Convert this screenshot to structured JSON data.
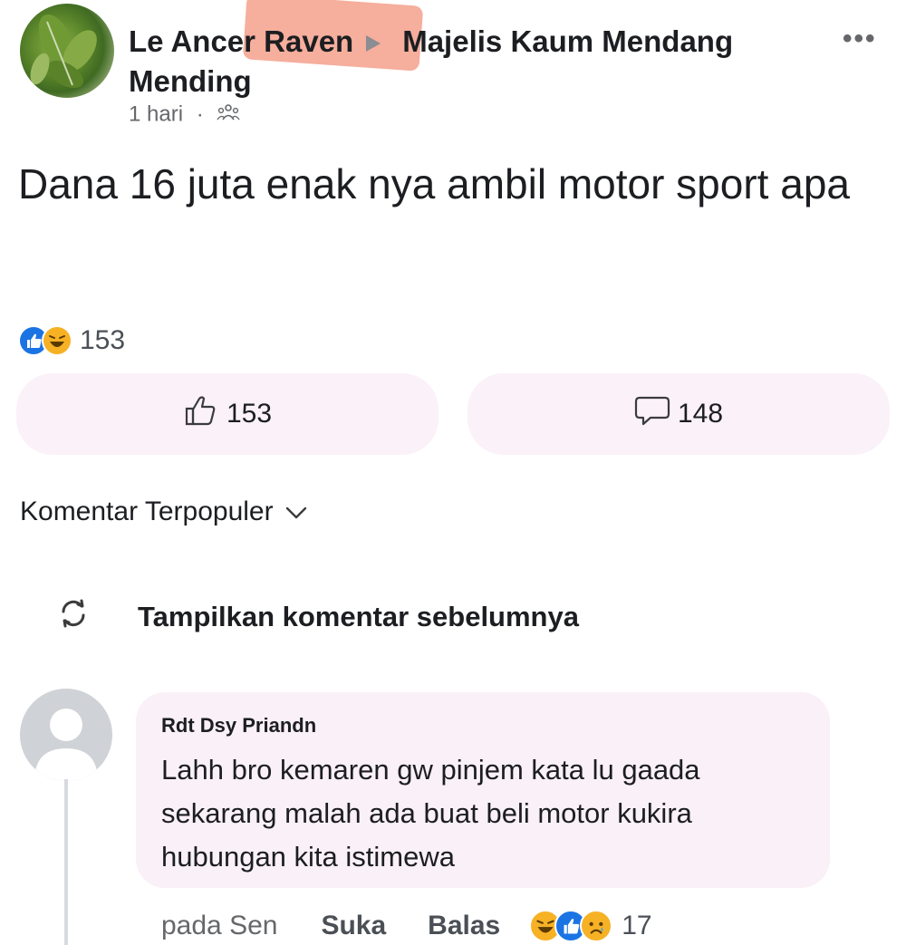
{
  "post": {
    "author": "Le Ancer Raven",
    "group_line1": "Majelis Kaum Mendang",
    "group_line2": "Mending",
    "time": "1 hari",
    "separator": "·",
    "more": "•••",
    "text": "Dana 16 juta enak nya ambil motor sport apa",
    "reaction_count": "153",
    "like_count": "153",
    "comment_count": "148"
  },
  "sort": {
    "label": "Komentar Terpopuler"
  },
  "previous_comments": {
    "label": "Tampilkan komentar sebelumnya"
  },
  "comment": {
    "author": "Rdt Dsy Priandn",
    "text": "Lahh bro kemaren gw pinjem kata lu gaada sekarang malah ada buat beli motor kukira hubungan kita istimewa",
    "time": "pada Sen",
    "like_label": "Suka",
    "reply_label": "Balas",
    "reaction_count": "17"
  },
  "icons": {
    "avatar": "leaf-photo-avatar",
    "audience": "group-members-icon",
    "like": "thumbs-up-icon",
    "comment": "speech-bubble-icon",
    "sort": "chevron-down-icon",
    "refresh": "refresh-icon"
  },
  "colors": {
    "like_blue": "#1b74e4",
    "haha_yellow": "#f7b125",
    "button_bg": "#fbf1f8",
    "highlight": "#f28b74"
  }
}
